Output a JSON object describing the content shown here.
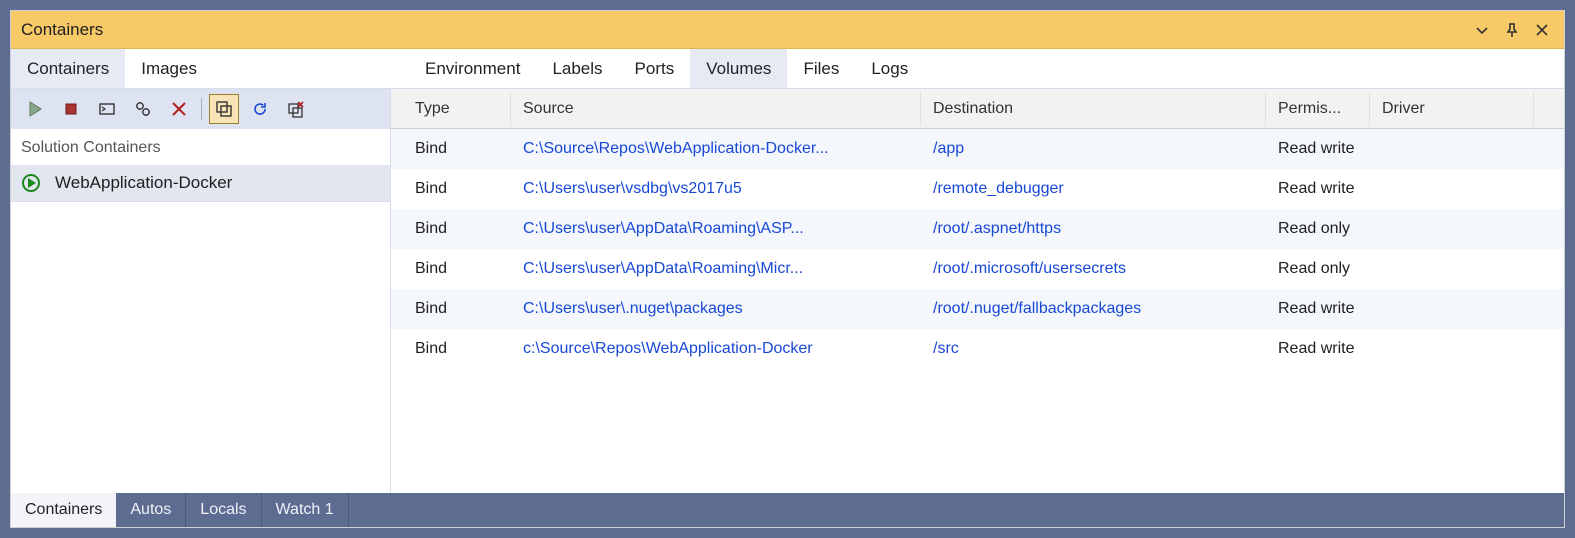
{
  "window": {
    "title": "Containers"
  },
  "top_tabs": {
    "left": [
      {
        "label": "Containers",
        "active": true
      },
      {
        "label": "Images",
        "active": false
      }
    ],
    "detail": [
      {
        "label": "Environment",
        "active": false
      },
      {
        "label": "Labels",
        "active": false
      },
      {
        "label": "Ports",
        "active": false
      },
      {
        "label": "Volumes",
        "active": true
      },
      {
        "label": "Files",
        "active": false
      },
      {
        "label": "Logs",
        "active": false
      }
    ]
  },
  "sidebar": {
    "category": "Solution Containers",
    "items": [
      {
        "label": "WebApplication-Docker",
        "running": true,
        "selected": true
      }
    ]
  },
  "columns": {
    "type": "Type",
    "source": "Source",
    "destination": "Destination",
    "permissions": "Permis...",
    "driver": "Driver"
  },
  "volumes": [
    {
      "type": "Bind",
      "source": "C:\\Source\\Repos\\WebApplication-Docker...",
      "destination": "/app",
      "permissions": "Read write",
      "driver": ""
    },
    {
      "type": "Bind",
      "source": "C:\\Users\\user\\vsdbg\\vs2017u5",
      "destination": "/remote_debugger",
      "permissions": "Read write",
      "driver": ""
    },
    {
      "type": "Bind",
      "source": "C:\\Users\\user\\AppData\\Roaming\\ASP...",
      "destination": "/root/.aspnet/https",
      "permissions": "Read only",
      "driver": ""
    },
    {
      "type": "Bind",
      "source": "C:\\Users\\user\\AppData\\Roaming\\Micr...",
      "destination": "/root/.microsoft/usersecrets",
      "permissions": "Read only",
      "driver": ""
    },
    {
      "type": "Bind",
      "source": "C:\\Users\\user\\.nuget\\packages",
      "destination": "/root/.nuget/fallbackpackages",
      "permissions": "Read write",
      "driver": ""
    },
    {
      "type": "Bind",
      "source": "c:\\Source\\Repos\\WebApplication-Docker",
      "destination": "/src",
      "permissions": "Read write",
      "driver": ""
    }
  ],
  "bottom_tabs": [
    {
      "label": "Containers",
      "active": true
    },
    {
      "label": "Autos",
      "active": false
    },
    {
      "label": "Locals",
      "active": false
    },
    {
      "label": "Watch 1",
      "active": false
    }
  ]
}
